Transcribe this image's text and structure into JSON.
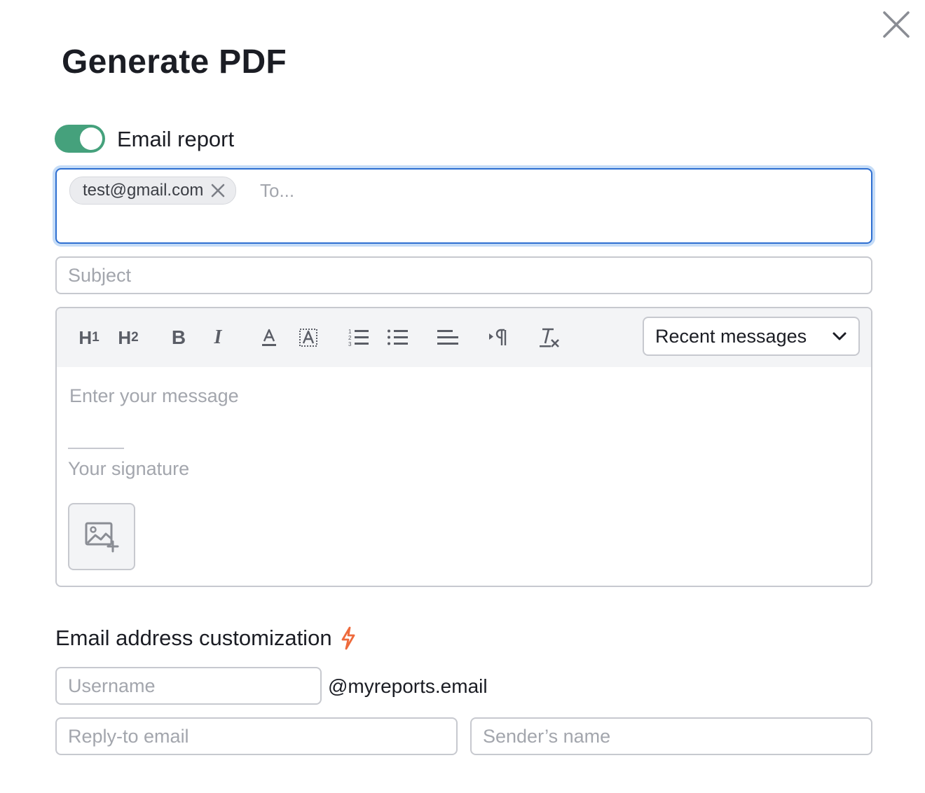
{
  "dialog": {
    "title": "Generate PDF"
  },
  "email_toggle": {
    "label": "Email report",
    "on": true
  },
  "recipients": {
    "chips": [
      "test@gmail.com"
    ],
    "placeholder": "To..."
  },
  "subject": {
    "placeholder": "Subject"
  },
  "editor": {
    "toolbar": {
      "h1": "H",
      "h1_sub": "1",
      "h2": "H",
      "h2_sub": "2",
      "bold": "B",
      "italic": "I"
    },
    "recent_messages": "Recent messages",
    "message_placeholder": "Enter your message",
    "signature_placeholder": "Your signature"
  },
  "customization": {
    "heading": "Email address customization",
    "username_placeholder": "Username",
    "domain": "@myreports.email",
    "reply_to_placeholder": "Reply-to email",
    "sender_name_placeholder": "Sender’s name"
  },
  "colors": {
    "toggle_on": "#45a17c",
    "focus_border": "#2e6fd1",
    "bolt": "#ee6a3c"
  }
}
